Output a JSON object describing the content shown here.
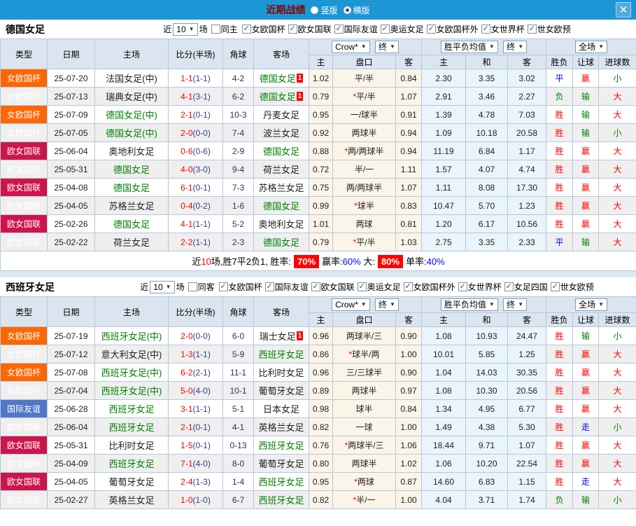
{
  "top_bar": {
    "title": "近期战绩",
    "radios": [
      {
        "label": "竖版",
        "checked": false
      },
      {
        "label": "横版",
        "checked": true
      }
    ],
    "close_icon": "✕"
  },
  "colors": {
    "bar_blue": "#1d96d5",
    "cup_orange": "#ff6600",
    "league_crimson": "#cc164b",
    "friendly_blue": "#5276c8",
    "team_green": "#008000",
    "score_red": "#ff0000",
    "handicap_bg": "#fbf4e8",
    "avg_bg": "#e9f4fb"
  },
  "columns": {
    "type": "类型",
    "date": "日期",
    "home": "主场",
    "score": "比分(半场)",
    "corner": "角球",
    "away": "客场",
    "sel_crow": "Crow*",
    "sel_final": "终",
    "sel_avg": "胜平负均值",
    "sel_full": "全场",
    "sub1": [
      "主",
      "盘口",
      "客"
    ],
    "sub2": [
      "主",
      "和",
      "客"
    ],
    "sub3": [
      "胜负",
      "让球",
      "进球数"
    ]
  },
  "sections": [
    {
      "team": "德国女足",
      "filter": {
        "prefix": "近",
        "count": "10",
        "suffix": "场",
        "same": "同主",
        "leagues": [
          "女欧国杯",
          "欧女国联",
          "国际友谊",
          "奥运女足",
          "女欧国杯外",
          "女世界杯",
          "世女欧预"
        ]
      },
      "rows": [
        {
          "tp": "女欧国杯",
          "dt": "25-07-20",
          "hm": "法国女足(中)",
          "hg": false,
          "hb": "",
          "ft": "1-1",
          "ht": "(1-1)",
          "cn": "4-2",
          "aw": "德国女足",
          "ag": true,
          "ab": "1",
          "o1": "1.02",
          "pk": "平/半",
          "o2": "0.84",
          "w1": "2.30",
          "w2": "3.35",
          "w3": "3.02",
          "r1": "平",
          "r2": "赢",
          "r3": "小"
        },
        {
          "tp": "女欧国杯",
          "dt": "25-07-13",
          "hm": "瑞典女足(中)",
          "hg": false,
          "hb": "",
          "ft": "4-1",
          "ht": "(3-1)",
          "cn": "6-2",
          "aw": "德国女足",
          "ag": true,
          "ab": "1",
          "o1": "0.79",
          "pk": "*平/半",
          "o2": "1.07",
          "w1": "2.91",
          "w2": "3.46",
          "w3": "2.27",
          "r1": "负",
          "r2": "输",
          "r3": "大"
        },
        {
          "tp": "女欧国杯",
          "dt": "25-07-09",
          "hm": "德国女足(中)",
          "hg": true,
          "hb": "",
          "ft": "2-1",
          "ht": "(0-1)",
          "cn": "10-3",
          "aw": "丹麦女足",
          "ag": false,
          "ab": "",
          "o1": "0.95",
          "pk": "一/球半",
          "o2": "0.91",
          "w1": "1.39",
          "w2": "4.78",
          "w3": "7.03",
          "r1": "胜",
          "r2": "输",
          "r3": "大"
        },
        {
          "tp": "女欧国杯",
          "dt": "25-07-05",
          "hm": "德国女足(中)",
          "hg": true,
          "hb": "",
          "ft": "2-0",
          "ht": "(0-0)",
          "cn": "7-4",
          "aw": "波兰女足",
          "ag": false,
          "ab": "",
          "o1": "0.92",
          "pk": "两球半",
          "o2": "0.94",
          "w1": "1.09",
          "w2": "10.18",
          "w3": "20.58",
          "r1": "胜",
          "r2": "输",
          "r3": "小"
        },
        {
          "tp": "欧女国联",
          "dt": "25-06-04",
          "hm": "奥地利女足",
          "hg": false,
          "hb": "",
          "ft": "0-6",
          "ht": "(0-6)",
          "cn": "2-9",
          "aw": "德国女足",
          "ag": true,
          "ab": "",
          "o1": "0.88",
          "pk": "*两/两球半",
          "o2": "0.94",
          "w1": "11.19",
          "w2": "6.84",
          "w3": "1.17",
          "r1": "胜",
          "r2": "赢",
          "r3": "大"
        },
        {
          "tp": "欧女国联",
          "dt": "25-05-31",
          "hm": "德国女足",
          "hg": true,
          "hb": "",
          "ft": "4-0",
          "ht": "(3-0)",
          "cn": "9-4",
          "aw": "荷兰女足",
          "ag": false,
          "ab": "",
          "o1": "0.72",
          "pk": "半/一",
          "o2": "1.11",
          "w1": "1.57",
          "w2": "4.07",
          "w3": "4.74",
          "r1": "胜",
          "r2": "赢",
          "r3": "大"
        },
        {
          "tp": "欧女国联",
          "dt": "25-04-08",
          "hm": "德国女足",
          "hg": true,
          "hb": "",
          "ft": "6-1",
          "ht": "(0-1)",
          "cn": "7-3",
          "aw": "苏格兰女足",
          "ag": false,
          "ab": "",
          "o1": "0.75",
          "pk": "两/两球半",
          "o2": "1.07",
          "w1": "1.11",
          "w2": "8.08",
          "w3": "17.30",
          "r1": "胜",
          "r2": "赢",
          "r3": "大"
        },
        {
          "tp": "欧女国联",
          "dt": "25-04-05",
          "hm": "苏格兰女足",
          "hg": false,
          "hb": "",
          "ft": "0-4",
          "ht": "(0-2)",
          "cn": "1-6",
          "aw": "德国女足",
          "ag": true,
          "ab": "",
          "o1": "0.99",
          "pk": "*球半",
          "o2": "0.83",
          "w1": "10.47",
          "w2": "5.70",
          "w3": "1.23",
          "r1": "胜",
          "r2": "赢",
          "r3": "大"
        },
        {
          "tp": "欧女国联",
          "dt": "25-02-26",
          "hm": "德国女足",
          "hg": true,
          "hb": "",
          "ft": "4-1",
          "ht": "(1-1)",
          "cn": "5-2",
          "aw": "奥地利女足",
          "ag": false,
          "ab": "",
          "o1": "1.01",
          "pk": "两球",
          "o2": "0.81",
          "w1": "1.20",
          "w2": "6.17",
          "w3": "10.56",
          "r1": "胜",
          "r2": "赢",
          "r3": "大"
        },
        {
          "tp": "欧女国联",
          "dt": "25-02-22",
          "hm": "荷兰女足",
          "hg": false,
          "hb": "",
          "ft": "2-2",
          "ht": "(1-1)",
          "cn": "2-3",
          "aw": "德国女足",
          "ag": true,
          "ab": "",
          "o1": "0.79",
          "pk": "*平/半",
          "o2": "1.03",
          "w1": "2.75",
          "w2": "3.35",
          "w3": "2.33",
          "r1": "平",
          "r2": "输",
          "r3": "大"
        }
      ],
      "summary": {
        "parts": [
          {
            "t": "近",
            "s": "k"
          },
          {
            "t": "10",
            "s": "red"
          },
          {
            "t": "场,胜7平2负1, 胜率:",
            "s": "k"
          },
          {
            "t": "70%",
            "s": "badge"
          },
          {
            "t": "赢率:",
            "s": "k"
          },
          {
            "t": "60%",
            "s": "blue"
          },
          {
            "t": " 大:",
            "s": "k"
          },
          {
            "t": "80%",
            "s": "badge"
          },
          {
            "t": "单率:",
            "s": "k"
          },
          {
            "t": "40%",
            "s": "blue"
          }
        ]
      }
    },
    {
      "team": "西班牙女足",
      "filter": {
        "prefix": "近",
        "count": "10",
        "suffix": "场",
        "same": "同客",
        "leagues": [
          "女欧国杯",
          "国际友谊",
          "欧女国联",
          "奥运女足",
          "女欧国杯外",
          "女世界杯",
          "女足四国",
          "世女欧预"
        ]
      },
      "rows": [
        {
          "tp": "女欧国杯",
          "dt": "25-07-19",
          "hm": "西班牙女足(中)",
          "hg": true,
          "hb": "",
          "ft": "2-0",
          "ht": "(0-0)",
          "cn": "6-0",
          "aw": "瑞士女足",
          "ag": false,
          "ab": "1",
          "o1": "0.96",
          "pk": "两球半/三",
          "o2": "0.90",
          "w1": "1.08",
          "w2": "10.93",
          "w3": "24.47",
          "r1": "胜",
          "r2": "输",
          "r3": "小"
        },
        {
          "tp": "女欧国杯",
          "dt": "25-07-12",
          "hm": "意大利女足(中)",
          "hg": false,
          "hb": "",
          "ft": "1-3",
          "ht": "(1-1)",
          "cn": "5-9",
          "aw": "西班牙女足",
          "ag": true,
          "ab": "",
          "o1": "0.86",
          "pk": "*球半/两",
          "o2": "1.00",
          "w1": "10.01",
          "w2": "5.85",
          "w3": "1.25",
          "r1": "胜",
          "r2": "赢",
          "r3": "大"
        },
        {
          "tp": "女欧国杯",
          "dt": "25-07-08",
          "hm": "西班牙女足(中)",
          "hg": true,
          "hb": "",
          "ft": "6-2",
          "ht": "(2-1)",
          "cn": "11-1",
          "aw": "比利时女足",
          "ag": false,
          "ab": "",
          "o1": "0.96",
          "pk": "三/三球半",
          "o2": "0.90",
          "w1": "1.04",
          "w2": "14.03",
          "w3": "30.35",
          "r1": "胜",
          "r2": "赢",
          "r3": "大"
        },
        {
          "tp": "女欧国杯",
          "dt": "25-07-04",
          "hm": "西班牙女足(中)",
          "hg": true,
          "hb": "",
          "ft": "5-0",
          "ht": "(4-0)",
          "cn": "10-1",
          "aw": "葡萄牙女足",
          "ag": false,
          "ab": "",
          "o1": "0.89",
          "pk": "两球半",
          "o2": "0.97",
          "w1": "1.08",
          "w2": "10.30",
          "w3": "20.56",
          "r1": "胜",
          "r2": "赢",
          "r3": "大"
        },
        {
          "tp": "国际友谊",
          "dt": "25-06-28",
          "hm": "西班牙女足",
          "hg": true,
          "hb": "",
          "ft": "3-1",
          "ht": "(1-1)",
          "cn": "5-1",
          "aw": "日本女足",
          "ag": false,
          "ab": "",
          "o1": "0.98",
          "pk": "球半",
          "o2": "0.84",
          "w1": "1.34",
          "w2": "4.95",
          "w3": "6.77",
          "r1": "胜",
          "r2": "赢",
          "r3": "大"
        },
        {
          "tp": "欧女国联",
          "dt": "25-06-04",
          "hm": "西班牙女足",
          "hg": true,
          "hb": "",
          "ft": "2-1",
          "ht": "(0-1)",
          "cn": "4-1",
          "aw": "英格兰女足",
          "ag": false,
          "ab": "",
          "o1": "0.82",
          "pk": "一球",
          "o2": "1.00",
          "w1": "1.49",
          "w2": "4.38",
          "w3": "5.30",
          "r1": "胜",
          "r2": "走",
          "r3": "小"
        },
        {
          "tp": "欧女国联",
          "dt": "25-05-31",
          "hm": "比利时女足",
          "hg": false,
          "hb": "",
          "ft": "1-5",
          "ht": "(0-1)",
          "cn": "0-13",
          "aw": "西班牙女足",
          "ag": true,
          "ab": "",
          "o1": "0.76",
          "pk": "*两球半/三",
          "o2": "1.06",
          "w1": "18.44",
          "w2": "9.71",
          "w3": "1.07",
          "r1": "胜",
          "r2": "赢",
          "r3": "大"
        },
        {
          "tp": "欧女国联",
          "dt": "25-04-09",
          "hm": "西班牙女足",
          "hg": true,
          "hb": "",
          "ft": "7-1",
          "ht": "(4-0)",
          "cn": "8-0",
          "aw": "葡萄牙女足",
          "ag": false,
          "ab": "",
          "o1": "0.80",
          "pk": "两球半",
          "o2": "1.02",
          "w1": "1.06",
          "w2": "10.20",
          "w3": "22.54",
          "r1": "胜",
          "r2": "赢",
          "r3": "大"
        },
        {
          "tp": "欧女国联",
          "dt": "25-04-05",
          "hm": "葡萄牙女足",
          "hg": false,
          "hb": "",
          "ft": "2-4",
          "ht": "(1-3)",
          "cn": "1-4",
          "aw": "西班牙女足",
          "ag": true,
          "ab": "",
          "o1": "0.95",
          "pk": "*两球",
          "o2": "0.87",
          "w1": "14.60",
          "w2": "6.83",
          "w3": "1.15",
          "r1": "胜",
          "r2": "走",
          "r3": "大"
        },
        {
          "tp": "欧女国联",
          "dt": "25-02-27",
          "hm": "英格兰女足",
          "hg": false,
          "hb": "",
          "ft": "1-0",
          "ht": "(1-0)",
          "cn": "6-7",
          "aw": "西班牙女足",
          "ag": true,
          "ab": "",
          "o1": "0.82",
          "pk": "*半/一",
          "o2": "1.00",
          "w1": "4.04",
          "w2": "3.71",
          "w3": "1.74",
          "r1": "负",
          "r2": "输",
          "r3": "小"
        }
      ]
    }
  ]
}
